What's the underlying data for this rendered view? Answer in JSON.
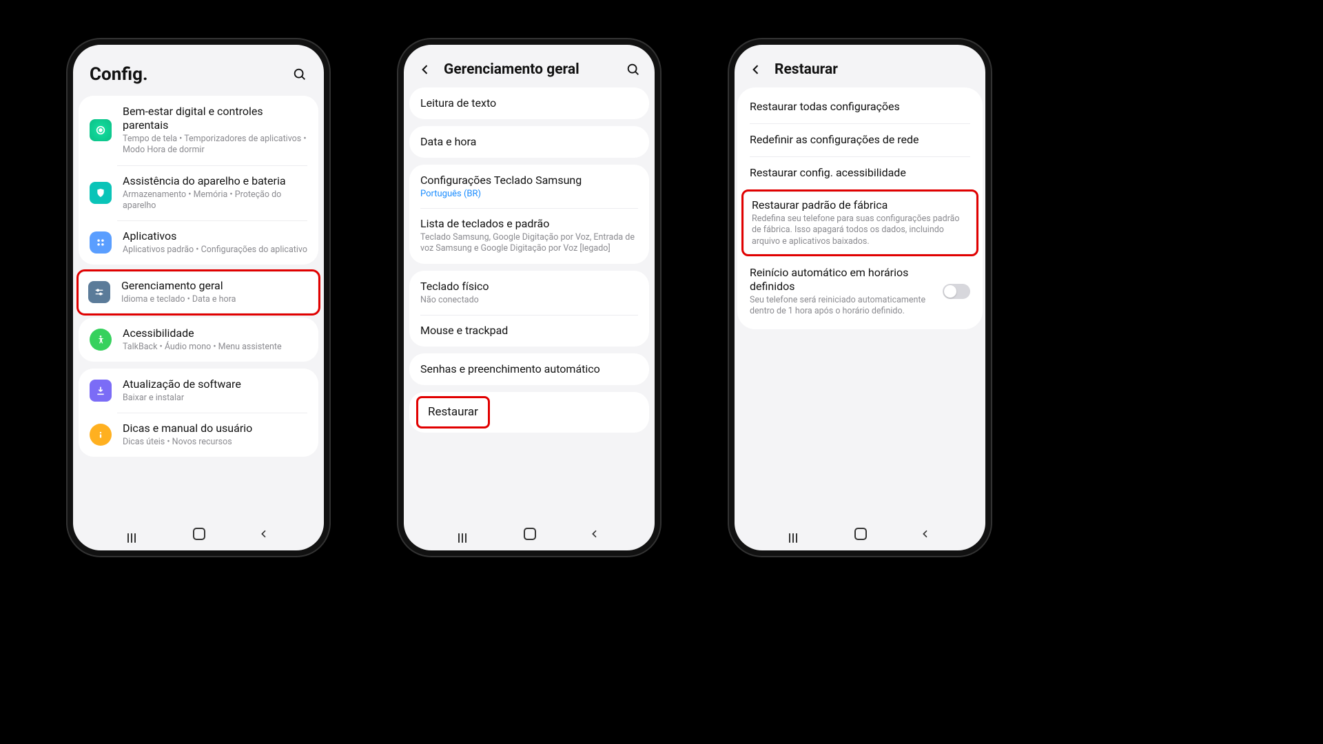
{
  "phone1": {
    "title": "Config.",
    "items": [
      {
        "title": "Bem-estar digital e controles parentais",
        "sub": "Tempo de tela  •  Temporizadores de aplicativos  •  Modo Hora de dormir"
      },
      {
        "title": "Assistência do aparelho e bateria",
        "sub": "Armazenamento  •  Memória  •  Proteção do aparelho"
      },
      {
        "title": "Aplicativos",
        "sub": "Aplicativos padrão  •  Configurações do aplicativo"
      },
      {
        "title": "Gerenciamento geral",
        "sub": "Idioma e teclado  •  Data e hora"
      },
      {
        "title": "Acessibilidade",
        "sub": "TalkBack  •  Áudio mono  •  Menu assistente"
      },
      {
        "title": "Atualização de software",
        "sub": "Baixar e instalar"
      },
      {
        "title": "Dicas e manual do usuário",
        "sub": "Dicas úteis  •  Novos recursos"
      }
    ]
  },
  "phone2": {
    "title": "Gerenciamento geral",
    "rows": {
      "r0": "Leitura de texto",
      "r1": "Data e hora",
      "r2": "Configurações Teclado Samsung",
      "r2link": "Português (BR)",
      "r3": "Lista de teclados e padrão",
      "r3sub": "Teclado Samsung, Google Digitação por Voz, Entrada de voz Samsung e Google Digitação por Voz [legado]",
      "r4": "Teclado físico",
      "r4sub": "Não conectado",
      "r5": "Mouse e trackpad",
      "r6": "Senhas e preenchimento automático",
      "r7": "Restaurar"
    }
  },
  "phone3": {
    "title": "Restaurar",
    "rows": {
      "r0": "Restaurar todas configurações",
      "r1": "Redefinir as configurações de rede",
      "r2": "Restaurar config. acessibilidade",
      "r3": "Restaurar padrão de fábrica",
      "r3sub": "Redefina seu telefone para suas configurações padrão de fábrica. Isso apagará todos os dados, incluindo arquivo e aplicativos baixados.",
      "r4": "Reinício automático em horários definidos",
      "r4sub": "Seu telefone será reiniciado automaticamente dentro de 1 hora após o horário definido."
    }
  }
}
